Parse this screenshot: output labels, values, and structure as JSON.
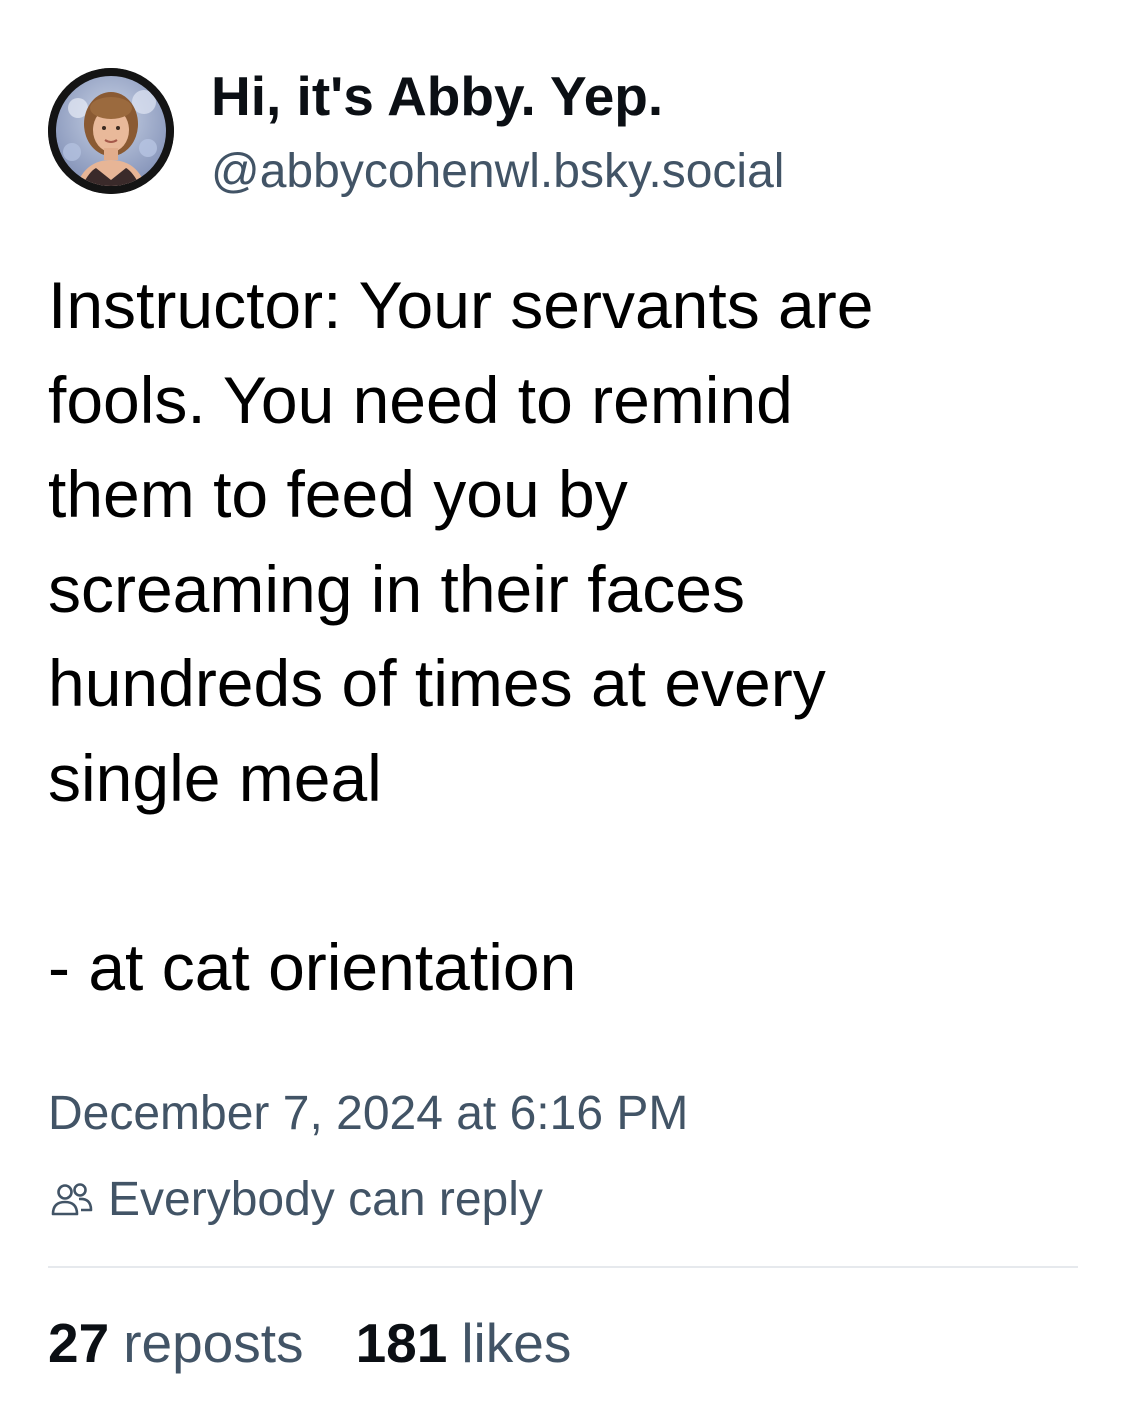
{
  "post": {
    "author": {
      "display_name": "Hi, it's Abby. Yep.",
      "handle": "@abbycohenwl.bsky.social",
      "avatar_icon": "profile-photo"
    },
    "text": "Instructor: Your servants are\nfools. You need to remind\nthem to feed you by\nscreaming in their faces\nhundreds of times at every\nsingle meal\n\n- at cat orientation",
    "timestamp": "December 7, 2024 at 6:16 PM",
    "reply_setting": {
      "icon": "people-icon",
      "label": "Everybody can reply"
    },
    "stats": {
      "reposts_count": "27",
      "reposts_label": "reposts",
      "likes_count": "181",
      "likes_label": "likes"
    }
  },
  "colors": {
    "primary_text": "#0b0f14",
    "secondary_text": "#425466",
    "divider": "#e6e9ed",
    "background": "#ffffff"
  }
}
